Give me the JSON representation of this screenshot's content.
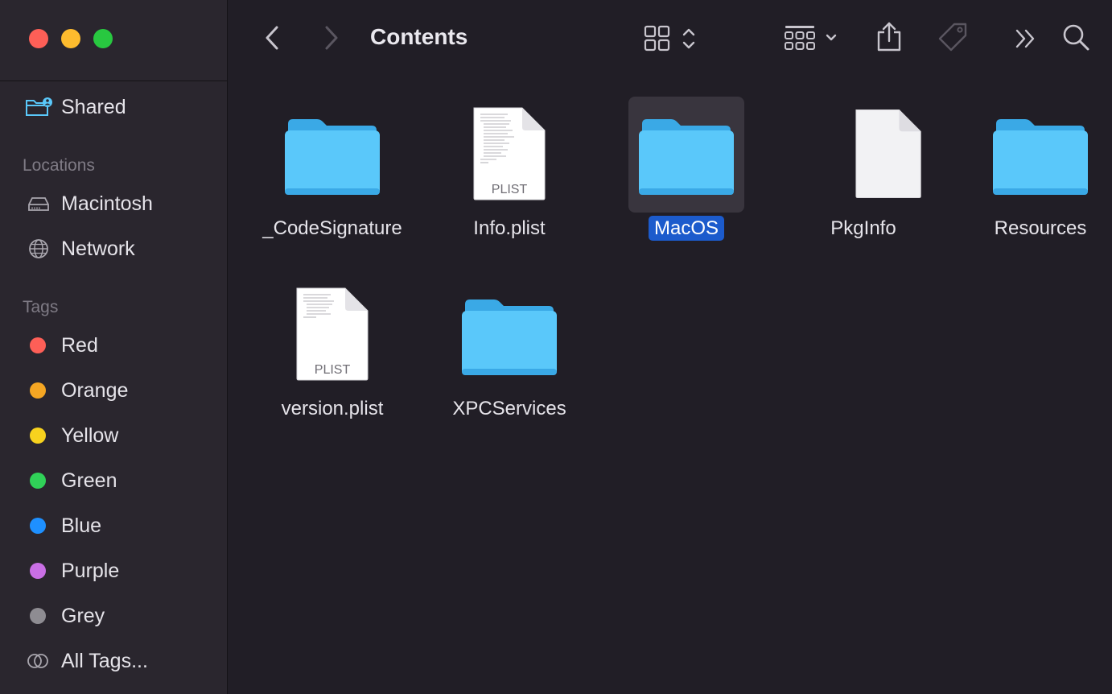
{
  "window": {
    "title": "Contents"
  },
  "sidebar": {
    "shared": {
      "label": "Shared"
    },
    "locations_header": "Locations",
    "locations": [
      {
        "label": "Macintosh",
        "icon": "drive-icon"
      },
      {
        "label": "Network",
        "icon": "globe-icon"
      }
    ],
    "tags_header": "Tags",
    "tags": [
      {
        "label": "Red",
        "color": "#fe5f57"
      },
      {
        "label": "Orange",
        "color": "#f5a623"
      },
      {
        "label": "Yellow",
        "color": "#f7d21e"
      },
      {
        "label": "Green",
        "color": "#30d158"
      },
      {
        "label": "Blue",
        "color": "#1e90ff"
      },
      {
        "label": "Purple",
        "color": "#c96fe5"
      },
      {
        "label": "Grey",
        "color": "#8e8c92"
      }
    ],
    "all_tags": {
      "label": "All Tags..."
    }
  },
  "toolbar": {
    "icons": [
      "back-icon",
      "forward-icon",
      "icon-view-icon",
      "group-by-icon",
      "share-icon",
      "tag-icon",
      "more-icon",
      "search-icon"
    ]
  },
  "items": [
    {
      "name": "_CodeSignature",
      "kind": "folder",
      "selected": false
    },
    {
      "name": "Info.plist",
      "kind": "plist",
      "badge": "PLIST",
      "selected": false
    },
    {
      "name": "MacOS",
      "kind": "folder",
      "selected": true
    },
    {
      "name": "PkgInfo",
      "kind": "document",
      "selected": false
    },
    {
      "name": "Resources",
      "kind": "folder",
      "selected": false
    },
    {
      "name": "version.plist",
      "kind": "plist",
      "badge": "PLIST",
      "selected": false
    },
    {
      "name": "XPCServices",
      "kind": "folder",
      "selected": false
    }
  ],
  "colors": {
    "accent": "#1c5bcc",
    "folder": "#5ac8fa",
    "background": "#211e26",
    "sidebar": "#2a262e"
  }
}
